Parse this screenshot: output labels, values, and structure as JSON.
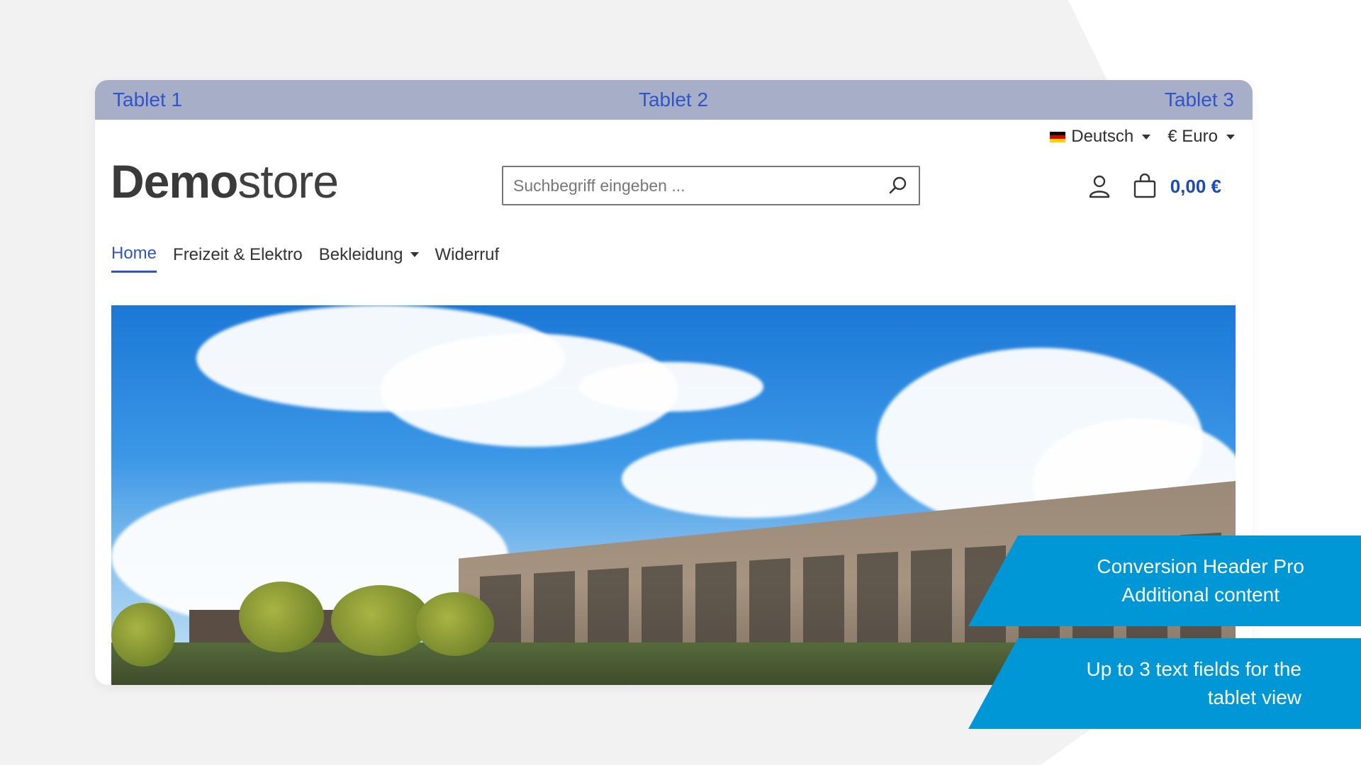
{
  "tablet_bar": {
    "labels": [
      "Tablet 1",
      "Tablet 2",
      "Tablet 3"
    ]
  },
  "topbar": {
    "language": "Deutsch",
    "currency": "€ Euro"
  },
  "logo": {
    "bold": "Demo",
    "light": "store"
  },
  "search": {
    "placeholder": "Suchbegriff eingeben ..."
  },
  "cart": {
    "total": "0,00 €"
  },
  "nav": {
    "items": [
      {
        "label": "Home",
        "active": true
      },
      {
        "label": "Freizeit & Elektro",
        "active": false
      },
      {
        "label": "Bekleidung",
        "active": false,
        "dropdown": true
      },
      {
        "label": "Widerruf",
        "active": false
      }
    ]
  },
  "callouts": {
    "first": {
      "line1": "Conversion Header Pro",
      "line2": "Additional content"
    },
    "second": {
      "line1": "Up to 3 text fields for the",
      "line2": "tablet view"
    }
  },
  "colors": {
    "accent": "#2f55c8",
    "callout": "#0097d6",
    "tablet_bar": "#a7afc8"
  }
}
